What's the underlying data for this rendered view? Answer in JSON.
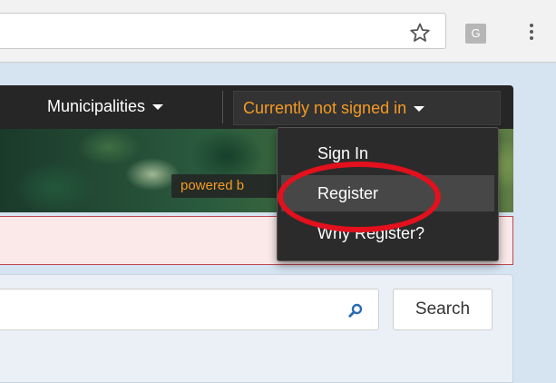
{
  "browser": {
    "extension_letter": "G",
    "icons": {
      "bookmark": "star-icon",
      "extension": "g-extension-icon",
      "menu": "kebab-menu-icon"
    }
  },
  "navbar": {
    "municipalities_label": "Municipalities",
    "account_label": "Currently not signed in",
    "accent_color": "#f59a23"
  },
  "banner": {
    "powered_text": "powered b"
  },
  "dropdown": {
    "items": [
      {
        "label": "Sign In"
      },
      {
        "label": "Register",
        "highlighted": true
      },
      {
        "label": "Why Register?"
      }
    ]
  },
  "annotation": {
    "type": "red-circle",
    "target": "Register",
    "color": "#e3101d"
  },
  "search": {
    "value": "",
    "button_label": "Search",
    "icon": "search-icon"
  }
}
